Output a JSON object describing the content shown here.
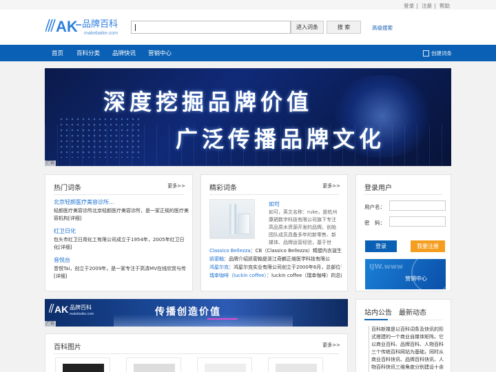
{
  "topbar": {
    "login": "登录",
    "register": "注册",
    "help": "帮助"
  },
  "header": {
    "logo_text": "AK",
    "logo_cn": "品牌百科",
    "logo_url": "makebaike.com",
    "search_value": "",
    "enter_button": "进入词条",
    "search_button": "搜 索",
    "advanced": "高级搜索"
  },
  "nav": {
    "items": [
      "首页",
      "百科分类",
      "品牌快讯",
      "营销中心"
    ],
    "create": "创建词条"
  },
  "banner": {
    "line1": "深度挖掘品牌价值",
    "line2": "广泛传播品牌文化",
    "ad": "广告"
  },
  "hot": {
    "title": "热门词条",
    "more": "更多>>",
    "entries": [
      {
        "title": "北京轻颜医疗美容诊所...",
        "desc": "轻颜医疗美容诊所北京轻颜医疗美容诊所，是一家正规的医疗美容机构[详细]"
      },
      {
        "title": "红卫日化",
        "desc": "包头市红卫日用化工有限公司成立于1954年，2005年红卫日化[详细]"
      },
      {
        "title": "音悦台",
        "desc": "音悦Tai，创立于2009年，是一家专注于高清MV在线欣赏与传[详细]"
      }
    ]
  },
  "featured": {
    "title": "精彩词条",
    "more": "更多>>",
    "top_title": "如可",
    "top_desc": "如可，英文名称：ruke，是杭州康硒数字科技有限公司旗下专注高品质水资源开发的品牌。创始团队成员具备多年的新零售、新媒体、品牌运营经验，基于世界“硒养之都”",
    "rows": [
      {
        "name": "Classico Bellezza",
        "text": "：CB（Classico Bellezza）精塑内衣诞生于2"
      },
      {
        "name": "凯密翰",
        "text": "：品牌介绍凯密翰是浙江奇麟正维医学科技有限公"
      },
      {
        "name": "鸿星尔克",
        "text": "：鸿星尔克实业有限公司创立于2000年6月，总部位于"
      },
      {
        "name": "瑞幸咖啡（luckin coffee）",
        "text": "：luckin coffee（瑞幸咖啡）的总部位"
      }
    ]
  },
  "login": {
    "title": "登录用户",
    "user_label": "用户名：",
    "pass_label": "密　码：",
    "login_button": "登录",
    "register_button": "我要注册",
    "market_watermark": "IJW.www",
    "market_label": "营销中心"
  },
  "banner2": {
    "logo_text": "AK",
    "logo_cn": "品牌百科",
    "logo_url": "makebaike.com",
    "slogan": "传播创造价值",
    "ad": "广告"
  },
  "notice": {
    "tab1": "站内公告",
    "tab2": "最新动态",
    "text": "百科新媒是以百科词条及快讯的形式搭建的一个商业自媒体矩阵。它以商业百科、品牌百科、人物百科三个传统百科网站为基础，同时从商业百科快讯、品牌百科快讯、人物百科快讯三维角度分别建设十余家垂直细分类网站，终将形成"
  },
  "pics": {
    "title": "百科图片",
    "more": "更多>>"
  },
  "colors": {
    "brand_blue": "#0a60b4",
    "link_blue": "#1a6fd0",
    "orange": "#f59d1e"
  }
}
